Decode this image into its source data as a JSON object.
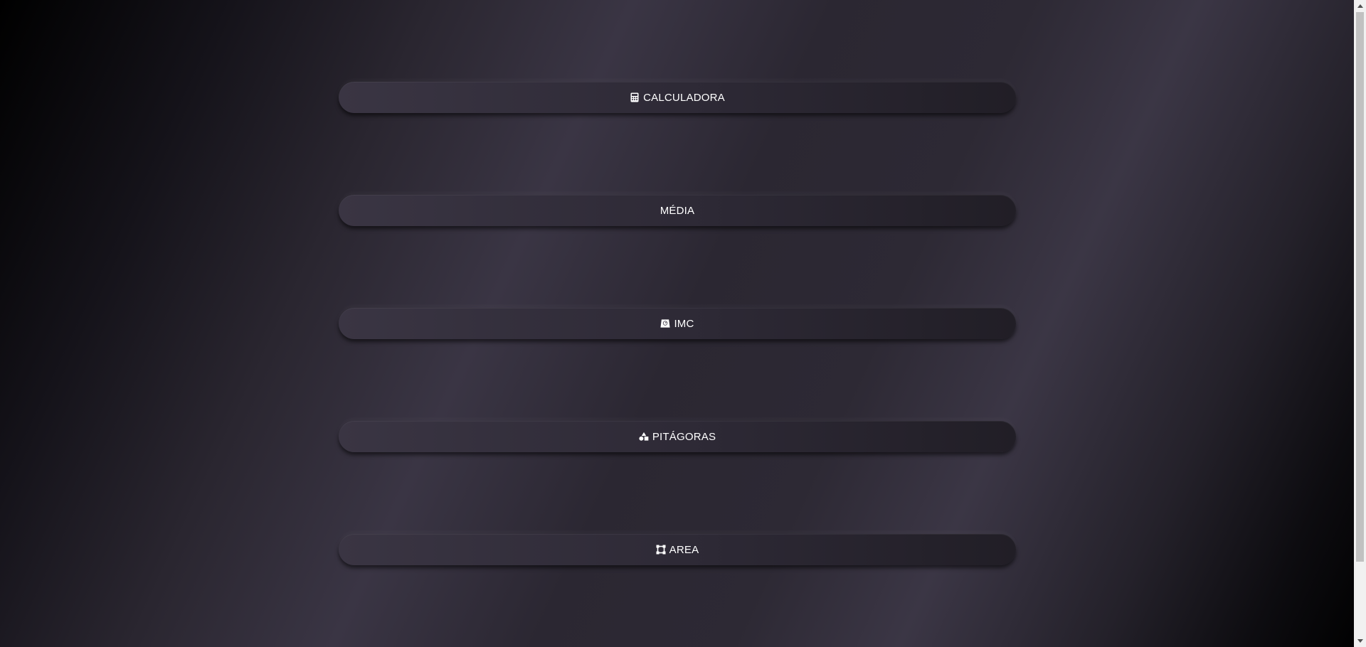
{
  "menu": {
    "items": [
      {
        "label": "CALCULADORA",
        "icon": "calculator-icon"
      },
      {
        "label": "MÉDIA",
        "icon": ""
      },
      {
        "label": "IMC",
        "icon": "scale-icon"
      },
      {
        "label": "PITÁGORAS",
        "icon": "shapes-icon"
      },
      {
        "label": "AREA",
        "icon": "area-icon"
      }
    ]
  },
  "colors": {
    "button_text": "#ffffff",
    "button_bg": "#2d2935",
    "background_highlight": "#3a3544"
  }
}
